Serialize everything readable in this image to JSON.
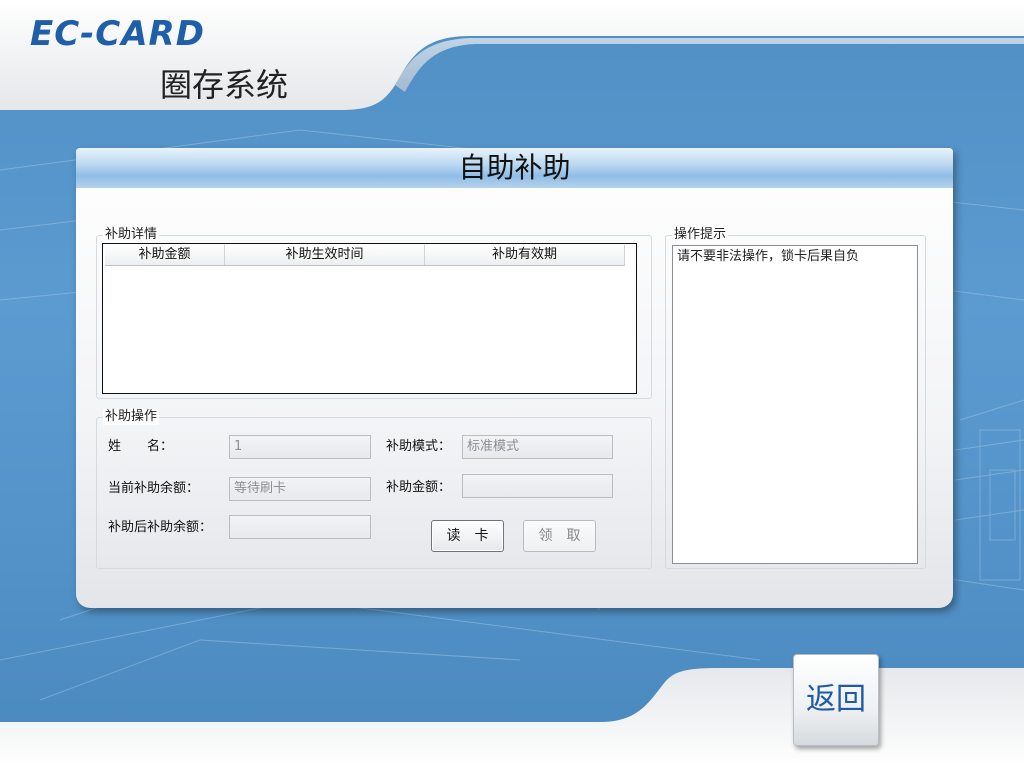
{
  "brand": {
    "logo_text": "EC-CARD",
    "system_title": "圈存系统"
  },
  "panel": {
    "title": "自助补助"
  },
  "details_group": {
    "label": "补助详情",
    "columns": [
      "补助金额",
      "补助生效时间",
      "补助有效期"
    ],
    "rows": []
  },
  "operation_group": {
    "label": "补助操作",
    "name_label": "姓　　名：",
    "name_value": "1",
    "mode_label": "补助模式：",
    "mode_value": "标准模式",
    "current_balance_label": "当前补助余额：",
    "current_balance_value": "等待刷卡",
    "amount_label": "补助金额：",
    "amount_value": "",
    "after_balance_label": "补助后补助余额：",
    "after_balance_value": "",
    "read_card_label": "读卡",
    "claim_label": "领取"
  },
  "hint_group": {
    "label": "操作提示",
    "text": "请不要非法操作，锁卡后果自负"
  },
  "back_button_label": "返回",
  "colors": {
    "accent": "#1e5aa8",
    "background": "#5393c9",
    "header_blue": "#8fbde6"
  }
}
